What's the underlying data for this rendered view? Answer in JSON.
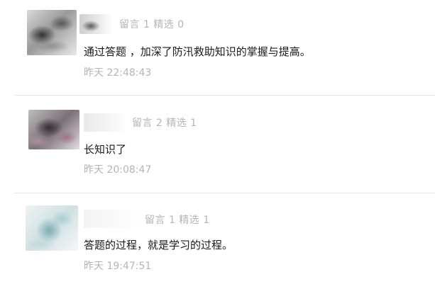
{
  "comments": [
    {
      "stats": "留言 1 精选 0",
      "text": "通过答题 ，加深了防汛救助知识的掌握与提高。",
      "time": "昨天 22:48:43"
    },
    {
      "stats": "留言 2 精选 1",
      "text": "长知识了",
      "time": "昨天 20:08:47"
    },
    {
      "stats": "留言 1 精选 1",
      "text": "答题的过程，就是学习的过程。",
      "time": "昨天 19:47:51"
    }
  ]
}
